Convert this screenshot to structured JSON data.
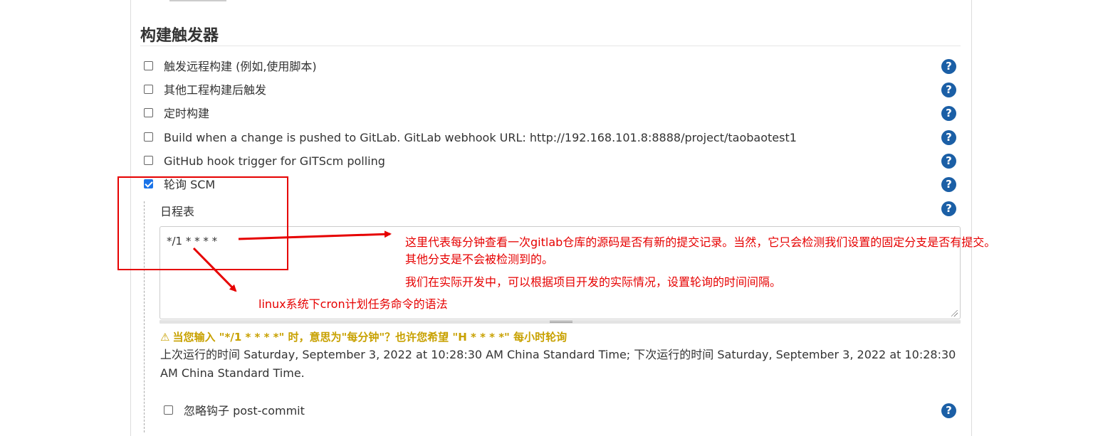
{
  "section": {
    "title": "构建触发器"
  },
  "triggers": [
    {
      "label": "触发远程构建 (例如,使用脚本)",
      "checked": false
    },
    {
      "label": "其他工程构建后触发",
      "checked": false
    },
    {
      "label": "定时构建",
      "checked": false
    },
    {
      "label": "Build when a change is pushed to GitLab. GitLab webhook URL: http://192.168.101.8:8888/project/taobaotest1",
      "checked": false
    },
    {
      "label": "GitHub hook trigger for GITScm polling",
      "checked": false
    },
    {
      "label": "轮询 SCM",
      "checked": true
    }
  ],
  "poll_scm": {
    "schedule_label": "日程表",
    "schedule_value": "*/1 * * * *",
    "warning": "当您输入 \"*/1 * * * *\" 时，意思为\"每分钟\"？也许您希望 \"H * * * *\" 每小时轮询",
    "run_info": "上次运行的时间 Saturday, September 3, 2022 at 10:28:30 AM China Standard Time; 下次运行的时间 Saturday, September 3, 2022 at 10:28:30 AM China Standard Time.",
    "ignore_hook_label": "忽略钩子 post-commit",
    "ignore_hook_checked": false
  },
  "help_icon": "?",
  "warning_icon": "warning-triangle-icon",
  "annotations": {
    "line1": "这里代表每分钟查看一次gitlab仓库的源码是否有新的提交记录。当然，它只会检测我们设置的固定分支是否有提交。",
    "line2": "其他分支是不会被检测到的。",
    "line3": "我们在实际开发中，可以根据项目开发的实际情况，设置轮询的时间间隔。",
    "line4": "linux系统下cron计划任务命令的语法",
    "color": "#e60000"
  },
  "colors": {
    "help": "#1b5fa6",
    "warning": "#c8a100",
    "checkbox_checked": "#1a73e8"
  }
}
